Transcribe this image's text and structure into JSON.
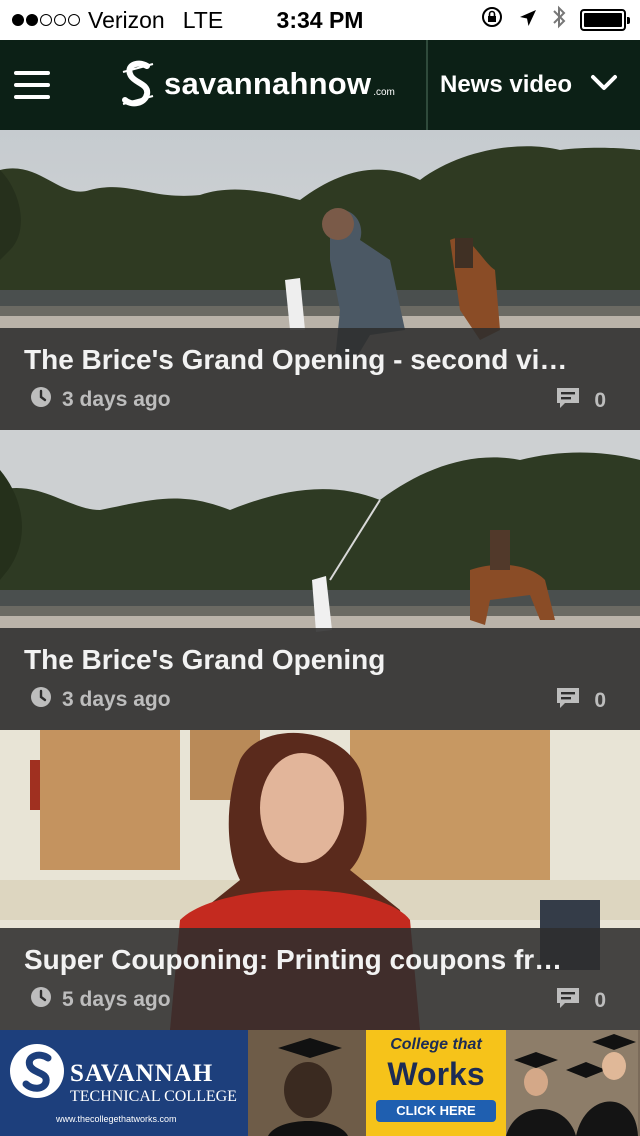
{
  "status_bar": {
    "signal_bars_filled": 2,
    "signal_bars_total": 5,
    "carrier": "Verizon",
    "network": "LTE",
    "time": "3:34 PM",
    "battery_level": 1.0,
    "icons": [
      "orientation-lock-icon",
      "location-arrow-icon",
      "bluetooth-icon",
      "battery-icon"
    ]
  },
  "nav": {
    "menu_icon": "hamburger-menu-icon",
    "logo_text": "savannahnow",
    "logo_suffix": ".com",
    "section_label": "News video",
    "section_icon": "chevron-down-icon"
  },
  "videos": [
    {
      "title": "The Brice's Grand Opening - second vi…",
      "time": "3 days ago",
      "comments": "0"
    },
    {
      "title": "The Brice's Grand Opening",
      "time": "3 days ago",
      "comments": "0"
    },
    {
      "title": "Super Couponing: Printing coupons fr…",
      "time": "5 days ago",
      "comments": "0"
    }
  ],
  "ad": {
    "name": "SAVANNAH",
    "subtitle": "TECHNICAL COLLEGE",
    "url": "www.thecollegethatworks.com",
    "tagline_1": "College that",
    "tagline_2": "Works",
    "button": "CLICK HERE"
  },
  "colors": {
    "nav_background": "#0c2016",
    "caption_overlay": "#2d2d2d",
    "ad_blue": "#1d3f7c",
    "ad_yellow": "#f6c31a"
  }
}
